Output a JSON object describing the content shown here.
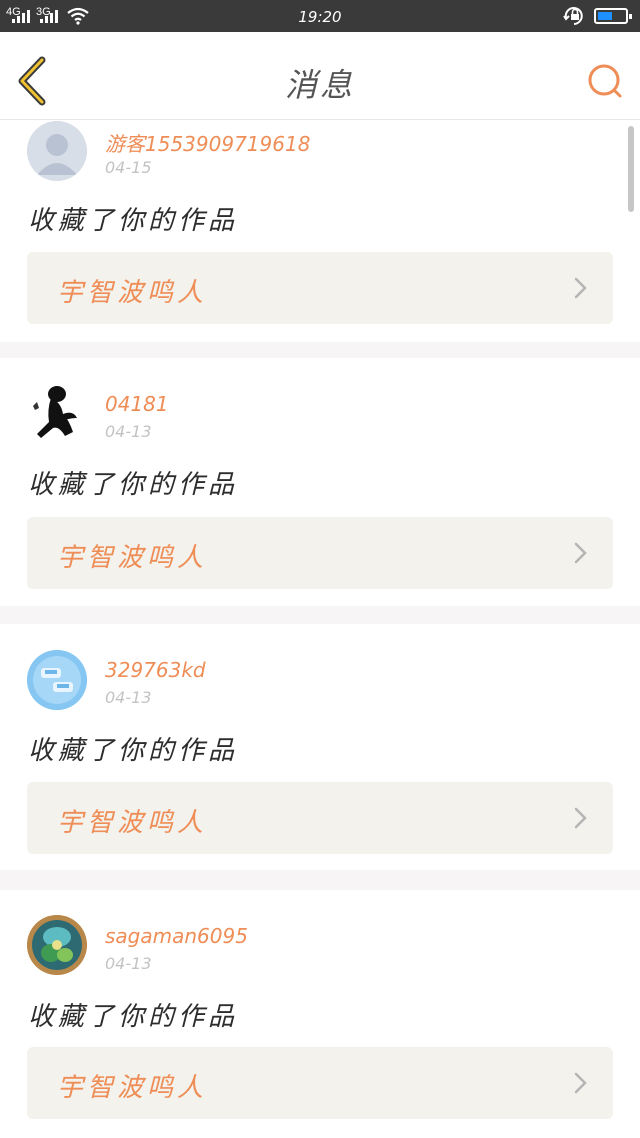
{
  "status_bar": {
    "network_1": "4G",
    "network_2": "3G",
    "time": "19:20",
    "battery_level": 0.55,
    "icons": [
      "signal-icon",
      "wifi-icon",
      "rotation-lock-icon",
      "battery-icon"
    ]
  },
  "nav": {
    "title": "消息",
    "back_icon": "chevron-left-icon",
    "search_icon": "search-icon",
    "accent": "#ef8d57"
  },
  "messages": [
    {
      "username": "游客1553909719618",
      "date": "04-15",
      "action": "收藏了你的作品",
      "work_title": "宇智波鸣人",
      "avatar": "default-avatar-icon"
    },
    {
      "username": "04181",
      "date": "04-13",
      "action": "收藏了你的作品",
      "work_title": "宇智波鸣人",
      "avatar": "silhouette-avatar"
    },
    {
      "username": "329763kd",
      "date": "04-13",
      "action": "收藏了你的作品",
      "work_title": "宇智波鸣人",
      "avatar": "blue-badge-avatar"
    },
    {
      "username": "sagaman6095",
      "date": "04-13",
      "action": "收藏了你的作品",
      "work_title": "宇智波鸣人",
      "avatar": "game-character-avatar"
    }
  ]
}
